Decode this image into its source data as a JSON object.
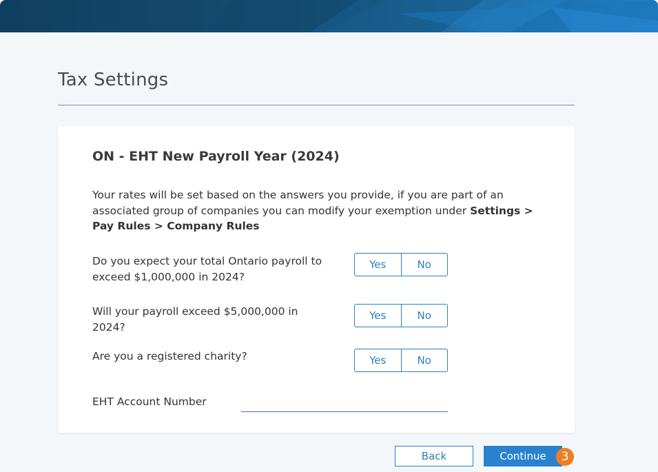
{
  "page": {
    "title": "Tax Settings"
  },
  "card": {
    "title": "ON - EHT New Payroll Year (2024)",
    "desc_plain": "Your rates will be set based on the answers you provide, if you are part of an associated group of companies you can modify your exemption under ",
    "desc_bold": "Settings > Pay Rules > Company Rules"
  },
  "questions": [
    {
      "text": "Do you expect your total Ontario payroll to exceed $1,000,000 in 2024?",
      "yes": "Yes",
      "no": "No"
    },
    {
      "text": "Will your payroll exceed $5,000,000 in 2024?",
      "yes": "Yes",
      "no": "No"
    },
    {
      "text": "Are you a registered charity?",
      "yes": "Yes",
      "no": "No"
    }
  ],
  "eht_field": {
    "label": "EHT Account Number",
    "value": ""
  },
  "footer": {
    "back_label": "Back",
    "continue_label": "Continue",
    "step_badge": "3"
  },
  "colors": {
    "accent": "#2a7ec1",
    "primary_button": "#2a82cf",
    "badge": "#f07d20",
    "header_dark": "#0f3f60",
    "header_light": "#1f80c8"
  }
}
